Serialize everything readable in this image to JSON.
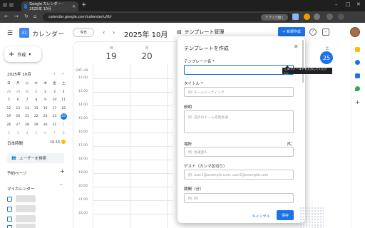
{
  "browser": {
    "tab_title": "Google カレンダー - 2025年 10月",
    "url": "calendar.google.com/calendar/u/0/r",
    "app_button": "アプリで開く"
  },
  "header": {
    "app_name": "カレンダー",
    "today": "今日",
    "month": "2025年 10月"
  },
  "sidebar": {
    "create": "作成",
    "mini_month": "2025年 10月",
    "weekdays": [
      "日",
      "月",
      "火",
      "水",
      "木",
      "金",
      "土"
    ],
    "weeks": [
      [
        "28",
        "29",
        "30",
        "1",
        "2",
        "3",
        "4"
      ],
      [
        "5",
        "6",
        "7",
        "8",
        "9",
        "10",
        "11"
      ],
      [
        "12",
        "13",
        "14",
        "15",
        "16",
        "17",
        "18"
      ],
      [
        "19",
        "20",
        "21",
        "22",
        "23",
        "24",
        "25"
      ],
      [
        "26",
        "27",
        "28",
        "29",
        "30",
        "31",
        "1"
      ],
      [
        "2",
        "3",
        "4",
        "5",
        "6",
        "7",
        "8"
      ]
    ],
    "selected_day": "25",
    "holiday_label": "日本時間",
    "time": "16:15",
    "search_users": "ユーザーを検索",
    "booking": "予約ページ",
    "my_calendars": "マイカレンダー"
  },
  "days": [
    {
      "label": "日",
      "num": "19"
    },
    {
      "label": "月",
      "num": "20"
    }
  ],
  "right_day": {
    "label": "土",
    "num": "25"
  },
  "gmt": "GMT+09",
  "hours": [
    "12:00",
    "13:00",
    "14:00",
    "15:00",
    "16:00",
    "17:00",
    "18:00",
    "19:00",
    "20:00",
    "21:00",
    "22:00"
  ],
  "panel": {
    "title": "テンプレート管理",
    "new_button": "+ 新規作成"
  },
  "modal": {
    "title": "テンプレートを作成",
    "template_name_label": "テンプレート名 *",
    "tooltip": "このフィールドを入力してください。",
    "title_label": "タイトル *",
    "title_placeholder": "例: チームミーティング",
    "desc_label": "説明",
    "desc_placeholder": "例: 週次のチーム定例会議",
    "location_label": "場所",
    "location_placeholder": "例: 会議室A",
    "guests_label": "ゲスト（カンマ区切り）",
    "guests_placeholder": "例: user1@example.com, user2@example.com",
    "duration_label": "期間（分）",
    "duration_placeholder": "例: 60",
    "cancel": "キャンセル",
    "save": "保存"
  }
}
